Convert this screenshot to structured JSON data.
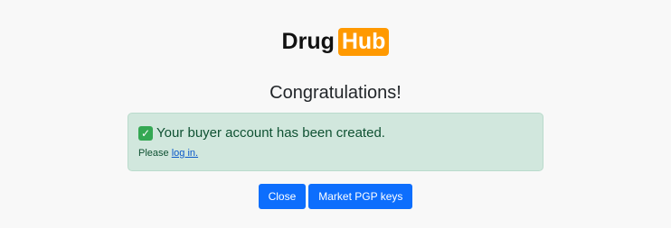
{
  "logo": {
    "word": "Drug",
    "badge": "Hub"
  },
  "heading": "Congratulations!",
  "alert": {
    "icon": "check-mark-icon",
    "message": "Your buyer account has been created.",
    "sub_prefix": "Please",
    "link_label": "log in."
  },
  "buttons": {
    "close_label": "Close",
    "pgp_label": "Market PGP keys"
  },
  "colors": {
    "brand_accent": "#ff9900",
    "alert_background": "#d1e7dd",
    "alert_text": "#0f5132",
    "button_primary": "#0d6efd",
    "page_background": "#f8f8f8"
  }
}
